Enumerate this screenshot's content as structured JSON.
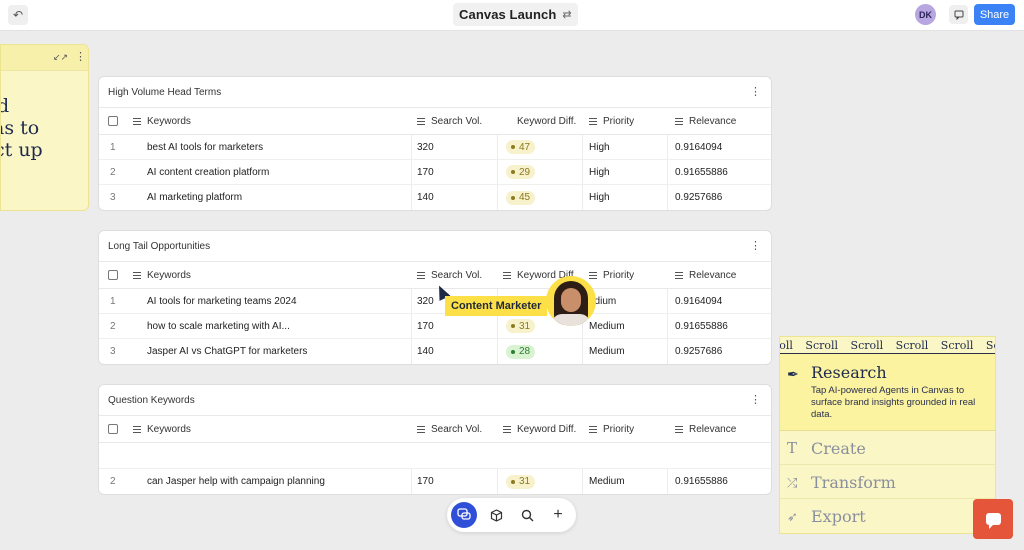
{
  "topbar": {
    "title": "Canvas Launch",
    "avatar_initials": "DK",
    "share_label": "Share"
  },
  "left_card": {
    "lines": [
      "d",
      "as to",
      "ct up"
    ]
  },
  "columns": {
    "keywords": "Keywords",
    "search_vol": "Search Vol.",
    "keyword_diff": "Keyword Diff.",
    "priority": "Priority",
    "relevance": "Relevance"
  },
  "tables": [
    {
      "name": "High Volume Head Terms",
      "rows": [
        {
          "num": "1",
          "keyword": "best AI tools for marketers",
          "search_vol": "320",
          "kd": "47",
          "priority": "High",
          "relevance": "0.9164094"
        },
        {
          "num": "2",
          "keyword": "AI content creation platform",
          "search_vol": "170",
          "kd": "29",
          "priority": "High",
          "relevance": "0.91655886"
        },
        {
          "num": "3",
          "keyword": "AI marketing platform",
          "search_vol": "140",
          "kd": "45",
          "priority": "High",
          "relevance": "0.9257686"
        }
      ]
    },
    {
      "name": "Long Tail Opportunities",
      "rows": [
        {
          "num": "1",
          "keyword": "AI tools for marketing teams 2024",
          "search_vol": "320",
          "kd": "",
          "priority": "edium",
          "relevance": "0.9164094"
        },
        {
          "num": "2",
          "keyword": "how to scale marketing with AI...",
          "search_vol": "170",
          "kd": "31",
          "priority": "Medium",
          "relevance": "0.91655886"
        },
        {
          "num": "3",
          "keyword": "Jasper AI vs ChatGPT for marketers",
          "search_vol": "140",
          "kd": "28",
          "priority": "Medium",
          "relevance": "0.9257686"
        }
      ]
    },
    {
      "name": "Question Keywords",
      "rows": [
        {
          "num": "2",
          "keyword": "can Jasper help with campaign planning",
          "search_vol": "170",
          "kd": "31",
          "priority": "Medium",
          "relevance": "0.91655886"
        }
      ]
    }
  ],
  "collaborator": {
    "label": "Content Marketer"
  },
  "right_panel": {
    "marquee_word": "Scroll",
    "marquee_lead": "roll",
    "research_title": "Research",
    "research_desc": "Tap AI-powered Agents in Canvas to surface brand insights grounded in real data.",
    "items": [
      "Create",
      "Transform",
      "Export"
    ]
  },
  "colors": {
    "accent": "#3b82f6",
    "yellow": "#fde047",
    "fab": "#e4553a"
  }
}
